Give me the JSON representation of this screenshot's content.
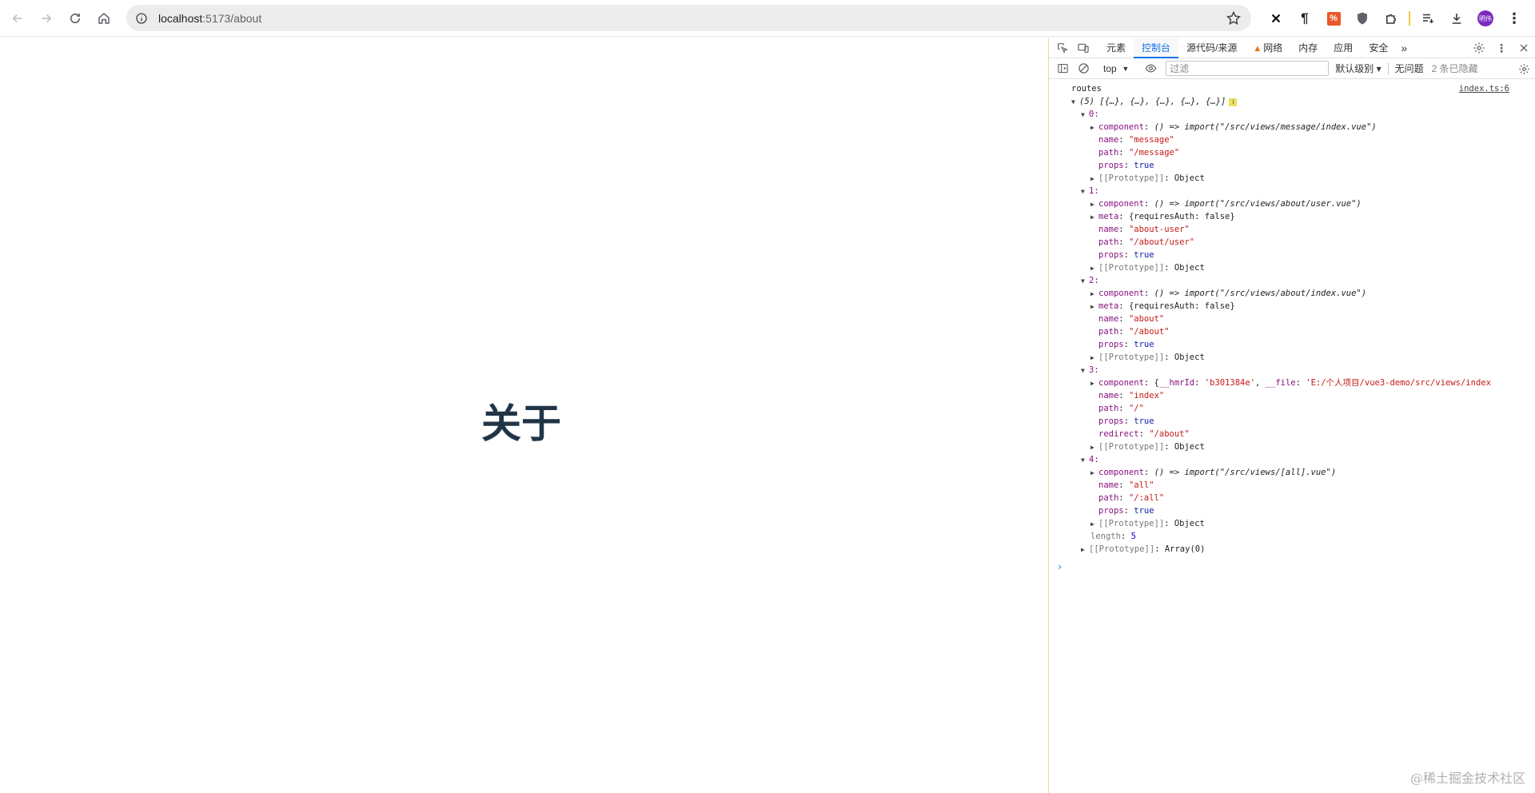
{
  "browser": {
    "url_host": "localhost",
    "url_path": ":5173/about",
    "avatar_label": "明伟"
  },
  "page": {
    "heading": "关于"
  },
  "devtools": {
    "tabs": [
      {
        "label": "元素"
      },
      {
        "label": "控制台"
      },
      {
        "label": "源代码/来源"
      },
      {
        "label": "网络"
      },
      {
        "label": "内存"
      },
      {
        "label": "应用"
      },
      {
        "label": "安全"
      }
    ],
    "more_tabs": "»",
    "context": "top",
    "filter_placeholder": "过滤",
    "level": "默认级别 ▾",
    "issues": "无问题",
    "hidden": "2 条已隐藏",
    "console": {
      "log_label": "routes",
      "source": "index.ts:6",
      "array_preview": "(5) [{…}, {…}, {…}, {…}, {…}]",
      "info_badge": "i",
      "length_key": "length",
      "length_val": "5",
      "array_proto": "[[Prototype]]",
      "array_proto_val": "Array(0)",
      "items": [
        {
          "index": "0:",
          "component": "() => import(\"/src/views/message/index.vue\")",
          "name": "\"message\"",
          "path": "\"/message\"",
          "props": "true"
        },
        {
          "index": "1:",
          "component": "() => import(\"/src/views/about/user.vue\")",
          "meta": "{requiresAuth: false}",
          "name": "\"about-user\"",
          "path": "\"/about/user\"",
          "props": "true"
        },
        {
          "index": "2:",
          "component": "() => import(\"/src/views/about/index.vue\")",
          "meta": "{requiresAuth: false}",
          "name": "\"about\"",
          "path": "\"/about\"",
          "props": "true"
        },
        {
          "index": "3:",
          "component_hmr_key": "__hmrId",
          "component_hmr_val": "'b301384e'",
          "component_file_key": "__file",
          "component_file_val": "'E:/个人项目/vue3-demo/src/views/index",
          "name": "\"index\"",
          "path": "\"/\"",
          "props": "true",
          "redirect": "\"/about\""
        },
        {
          "index": "4:",
          "component": "() => import(\"/src/views/[all].vue\")",
          "name": "\"all\"",
          "path": "\"/:all\"",
          "props": "true"
        }
      ],
      "proto_label": "[[Prototype]]",
      "proto_val": "Object"
    }
  },
  "watermark": "@稀土掘金技术社区"
}
